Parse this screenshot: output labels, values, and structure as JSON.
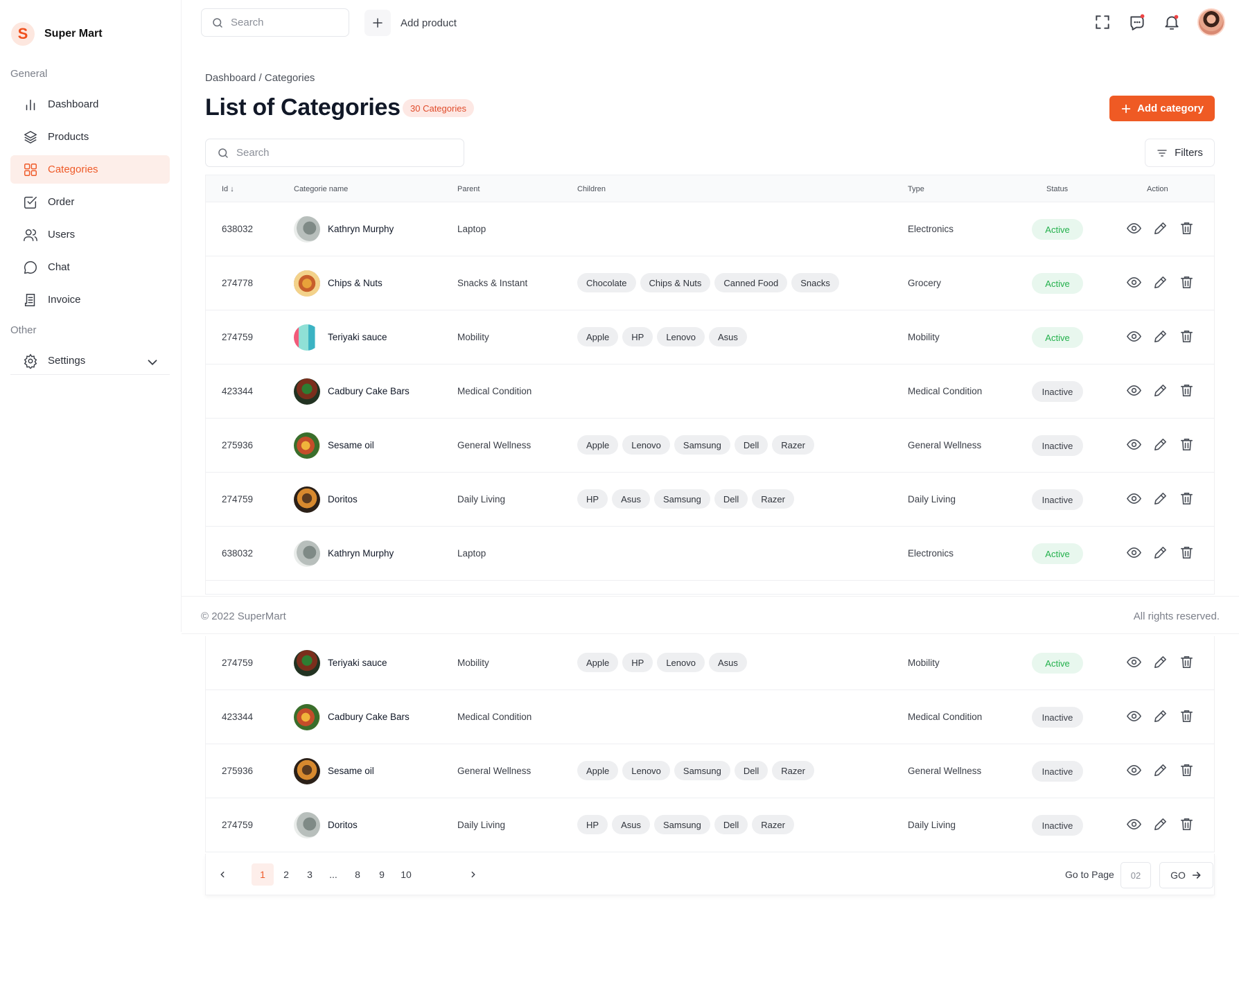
{
  "brand": {
    "logo_letter": "S",
    "name": "Super Mart",
    "accent": "#ef5a24"
  },
  "sidebar": {
    "general_label": "General",
    "other_label": "Other",
    "items": [
      {
        "label": "Dashboard",
        "icon": "bar-chart-icon"
      },
      {
        "label": "Products",
        "icon": "layers-icon"
      },
      {
        "label": "Categories",
        "icon": "grid-icon",
        "active": true
      },
      {
        "label": "Order",
        "icon": "checkbox-icon"
      },
      {
        "label": "Users",
        "icon": "users-icon"
      },
      {
        "label": "Chat",
        "icon": "chat-icon"
      },
      {
        "label": "Invoice",
        "icon": "invoice-icon"
      }
    ],
    "settings": {
      "label": "Settings",
      "icon": "gear-icon"
    }
  },
  "topbar": {
    "search_placeholder": "Search",
    "add_product_label": "Add product"
  },
  "page": {
    "breadcrumb": "Dashboard / Categories",
    "title": "List of Categories",
    "count_badge": "30 Categories",
    "add_category_label": "Add category",
    "search_placeholder": "Search",
    "filters_label": "Filters"
  },
  "table": {
    "headers": {
      "id": "Id",
      "name": "Categorie name",
      "parent": "Parent",
      "children": "Children",
      "type": "Type",
      "status": "Status",
      "action": "Action"
    },
    "rows": [
      {
        "id": "638032",
        "name": "Kathryn Murphy",
        "parent": "Laptop",
        "children": [],
        "type": "Electronics",
        "status": "Active"
      },
      {
        "id": "274778",
        "name": "Chips & Nuts",
        "parent": "Snacks & Instant",
        "children": [
          "Chocolate",
          "Chips & Nuts",
          "Canned Food",
          "Snacks"
        ],
        "type": "Grocery",
        "status": "Active"
      },
      {
        "id": "274759",
        "name": "Teriyaki sauce",
        "parent": "Mobility",
        "children": [
          "Apple",
          "HP",
          "Lenovo",
          "Asus"
        ],
        "type": "Mobility",
        "status": "Active"
      },
      {
        "id": "423344",
        "name": "Cadbury Cake Bars",
        "parent": "Medical Condition",
        "children": [],
        "type": "Medical Condition",
        "status": "Inactive"
      },
      {
        "id": "275936",
        "name": "Sesame oil",
        "parent": "General Wellness",
        "children": [
          "Apple",
          "Lenovo",
          "Samsung",
          "Dell",
          "Razer"
        ],
        "type": "General Wellness",
        "status": "Inactive"
      },
      {
        "id": "274759",
        "name": "Doritos",
        "parent": "Daily Living",
        "children": [
          "HP",
          "Asus",
          "Samsung",
          "Dell",
          "Razer"
        ],
        "type": "Daily Living",
        "status": "Inactive"
      },
      {
        "id": "638032",
        "name": "Kathryn Murphy",
        "parent": "Laptop",
        "children": [],
        "type": "Electronics",
        "status": "Active"
      }
    ],
    "rows_below": [
      {
        "id": "274759",
        "name": "Teriyaki sauce",
        "parent": "Mobility",
        "children": [
          "Apple",
          "HP",
          "Lenovo",
          "Asus"
        ],
        "type": "Mobility",
        "status": "Active"
      },
      {
        "id": "423344",
        "name": "Cadbury Cake Bars",
        "parent": "Medical Condition",
        "children": [],
        "type": "Medical Condition",
        "status": "Inactive"
      },
      {
        "id": "275936",
        "name": "Sesame oil",
        "parent": "General Wellness",
        "children": [
          "Apple",
          "Lenovo",
          "Samsung",
          "Dell",
          "Razer"
        ],
        "type": "General Wellness",
        "status": "Inactive"
      },
      {
        "id": "274759",
        "name": "Doritos",
        "parent": "Daily Living",
        "children": [
          "HP",
          "Asus",
          "Samsung",
          "Dell",
          "Razer"
        ],
        "type": "Daily Living",
        "status": "Inactive"
      }
    ]
  },
  "footer": {
    "copyright": "© 2022 SuperMart",
    "rights": "All rights reserved."
  },
  "pagination": {
    "pages": [
      "1",
      "2",
      "3",
      "...",
      "8",
      "9",
      "10"
    ],
    "current": "1",
    "goto_label": "Go to Page",
    "goto_value": "02",
    "go_label": "GO"
  }
}
